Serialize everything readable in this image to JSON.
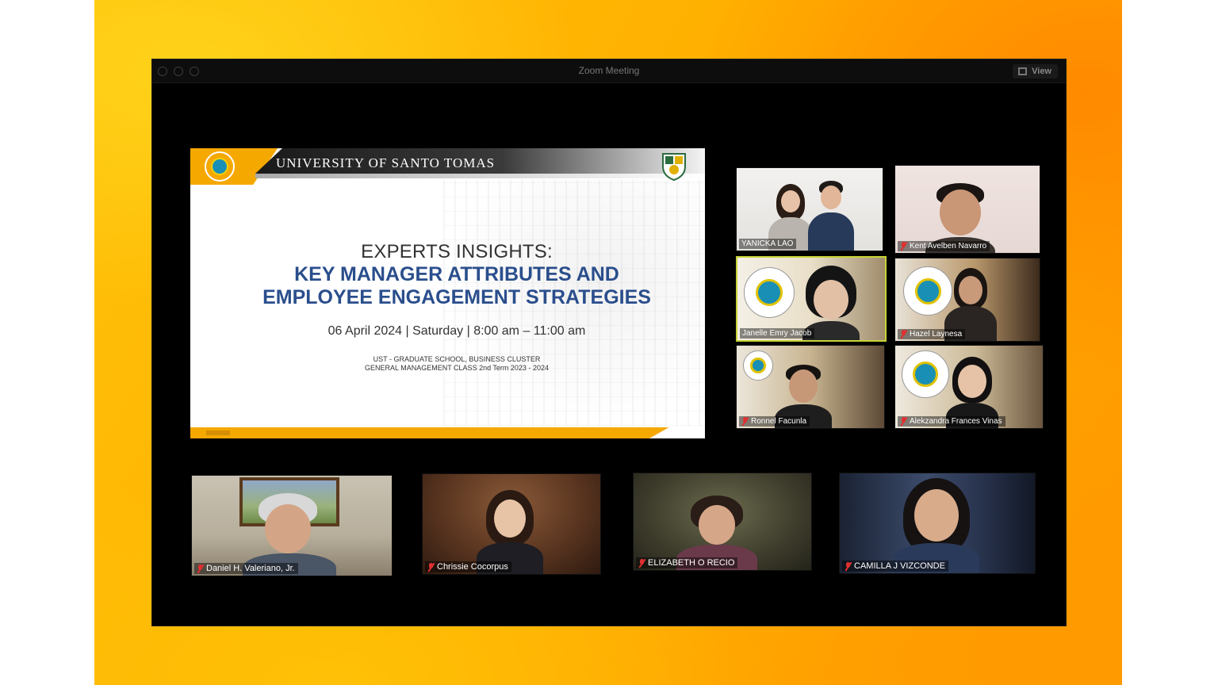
{
  "window": {
    "title": "Zoom Meeting",
    "view_label": "View"
  },
  "slide": {
    "university": "UNIVERSITY OF SANTO TOMAS",
    "line1": "EXPERTS INSIGHTS:",
    "line2": "KEY MANAGER ATTRIBUTES AND",
    "line3": "EMPLOYEE ENGAGEMENT STRATEGIES",
    "date": "06 April 2024 | Saturday | 8:00 am – 11:00 am",
    "sub1": "UST - GRADUATE SCHOOL, BUSINESS CLUSTER",
    "sub2": "GENERAL MANAGEMENT CLASS 2nd Term 2023 - 2024"
  },
  "gallery": [
    {
      "name": "YANICKA LAO",
      "muted": false
    },
    {
      "name": "Kent Avelben Navarro",
      "muted": true
    },
    {
      "name": "Janelle Emry Jacob",
      "muted": false
    },
    {
      "name": "Hazel Laynesa",
      "muted": true
    },
    {
      "name": "Ronnel Facunla",
      "muted": true
    },
    {
      "name": "Alekzandra Frances Vinas",
      "muted": true
    }
  ],
  "bottom_row": [
    {
      "name": "Daniel H. Valeriano, Jr.",
      "muted": true
    },
    {
      "name": "Chrissie Cocorpus",
      "muted": true
    },
    {
      "name": "ELIZABETH O RECIO",
      "muted": true
    },
    {
      "name": "CAMILLA J VIZCONDE",
      "muted": true
    }
  ],
  "colors": {
    "ust_gold": "#f5a800",
    "slide_blue": "#2a4e8c",
    "active_speaker": "#c8d436",
    "muted_red": "#e03030"
  }
}
